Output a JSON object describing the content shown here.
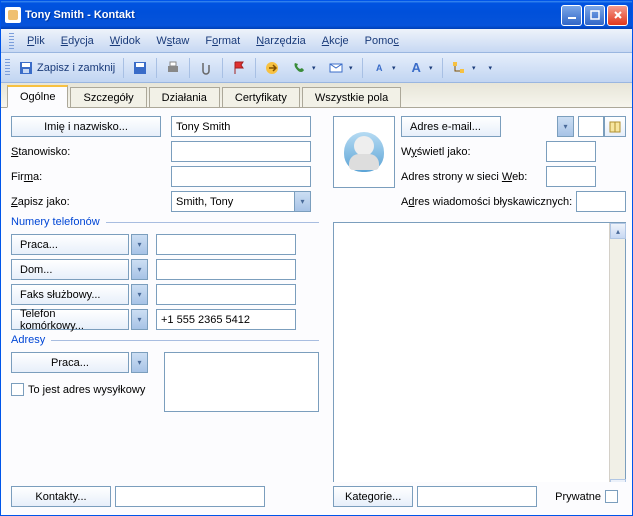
{
  "window": {
    "title": "Tony Smith - Kontakt"
  },
  "menu": {
    "plik": "Plik",
    "edycja": "Edycja",
    "widok": "Widok",
    "wstaw": "Wstaw",
    "format": "Format",
    "narzedzia": "Narzędzia",
    "akcje": "Akcje",
    "pomoc": "Pomoc"
  },
  "toolbar": {
    "save_close": "Zapisz i zamknij"
  },
  "tabs": {
    "ogolne": "Ogólne",
    "szczegoly": "Szczegóły",
    "dzialania": "Działania",
    "certyfikaty": "Certyfikaty",
    "wszystkie": "Wszystkie pola"
  },
  "labels": {
    "full_name_btn": "Imię i nazwisko...",
    "stanowisko": "Stanowisko:",
    "firma": "Firma:",
    "zapisz_jako": "Zapisz jako:",
    "numery_tel": "Numery telefonów",
    "praca": "Praca...",
    "dom": "Dom...",
    "faks": "Faks służbowy...",
    "komorka": "Telefon komórkowy...",
    "adresy": "Adresy",
    "praca_addr": "Praca...",
    "to_jest_adres": "To jest adres wysyłkowy",
    "adres_email": "Adres e-mail...",
    "wyswietl_jako": "Wyświetl jako:",
    "web": "Adres strony w sieci Web:",
    "im": "Adres wiadomości błyskawicznych:",
    "kontakty": "Kontakty...",
    "kategorie": "Kategorie...",
    "prywatne": "Prywatne"
  },
  "values": {
    "full_name": "Tony Smith",
    "stanowisko": "",
    "firma": "",
    "zapisz_jako": "Smith, Tony",
    "tel_praca": "",
    "tel_dom": "",
    "tel_faks": "",
    "tel_komorka": "+1 555 2365 5412",
    "email": "",
    "wyswietl": "",
    "web": "",
    "im": "",
    "kontakty_val": "",
    "kategorie_val": ""
  }
}
